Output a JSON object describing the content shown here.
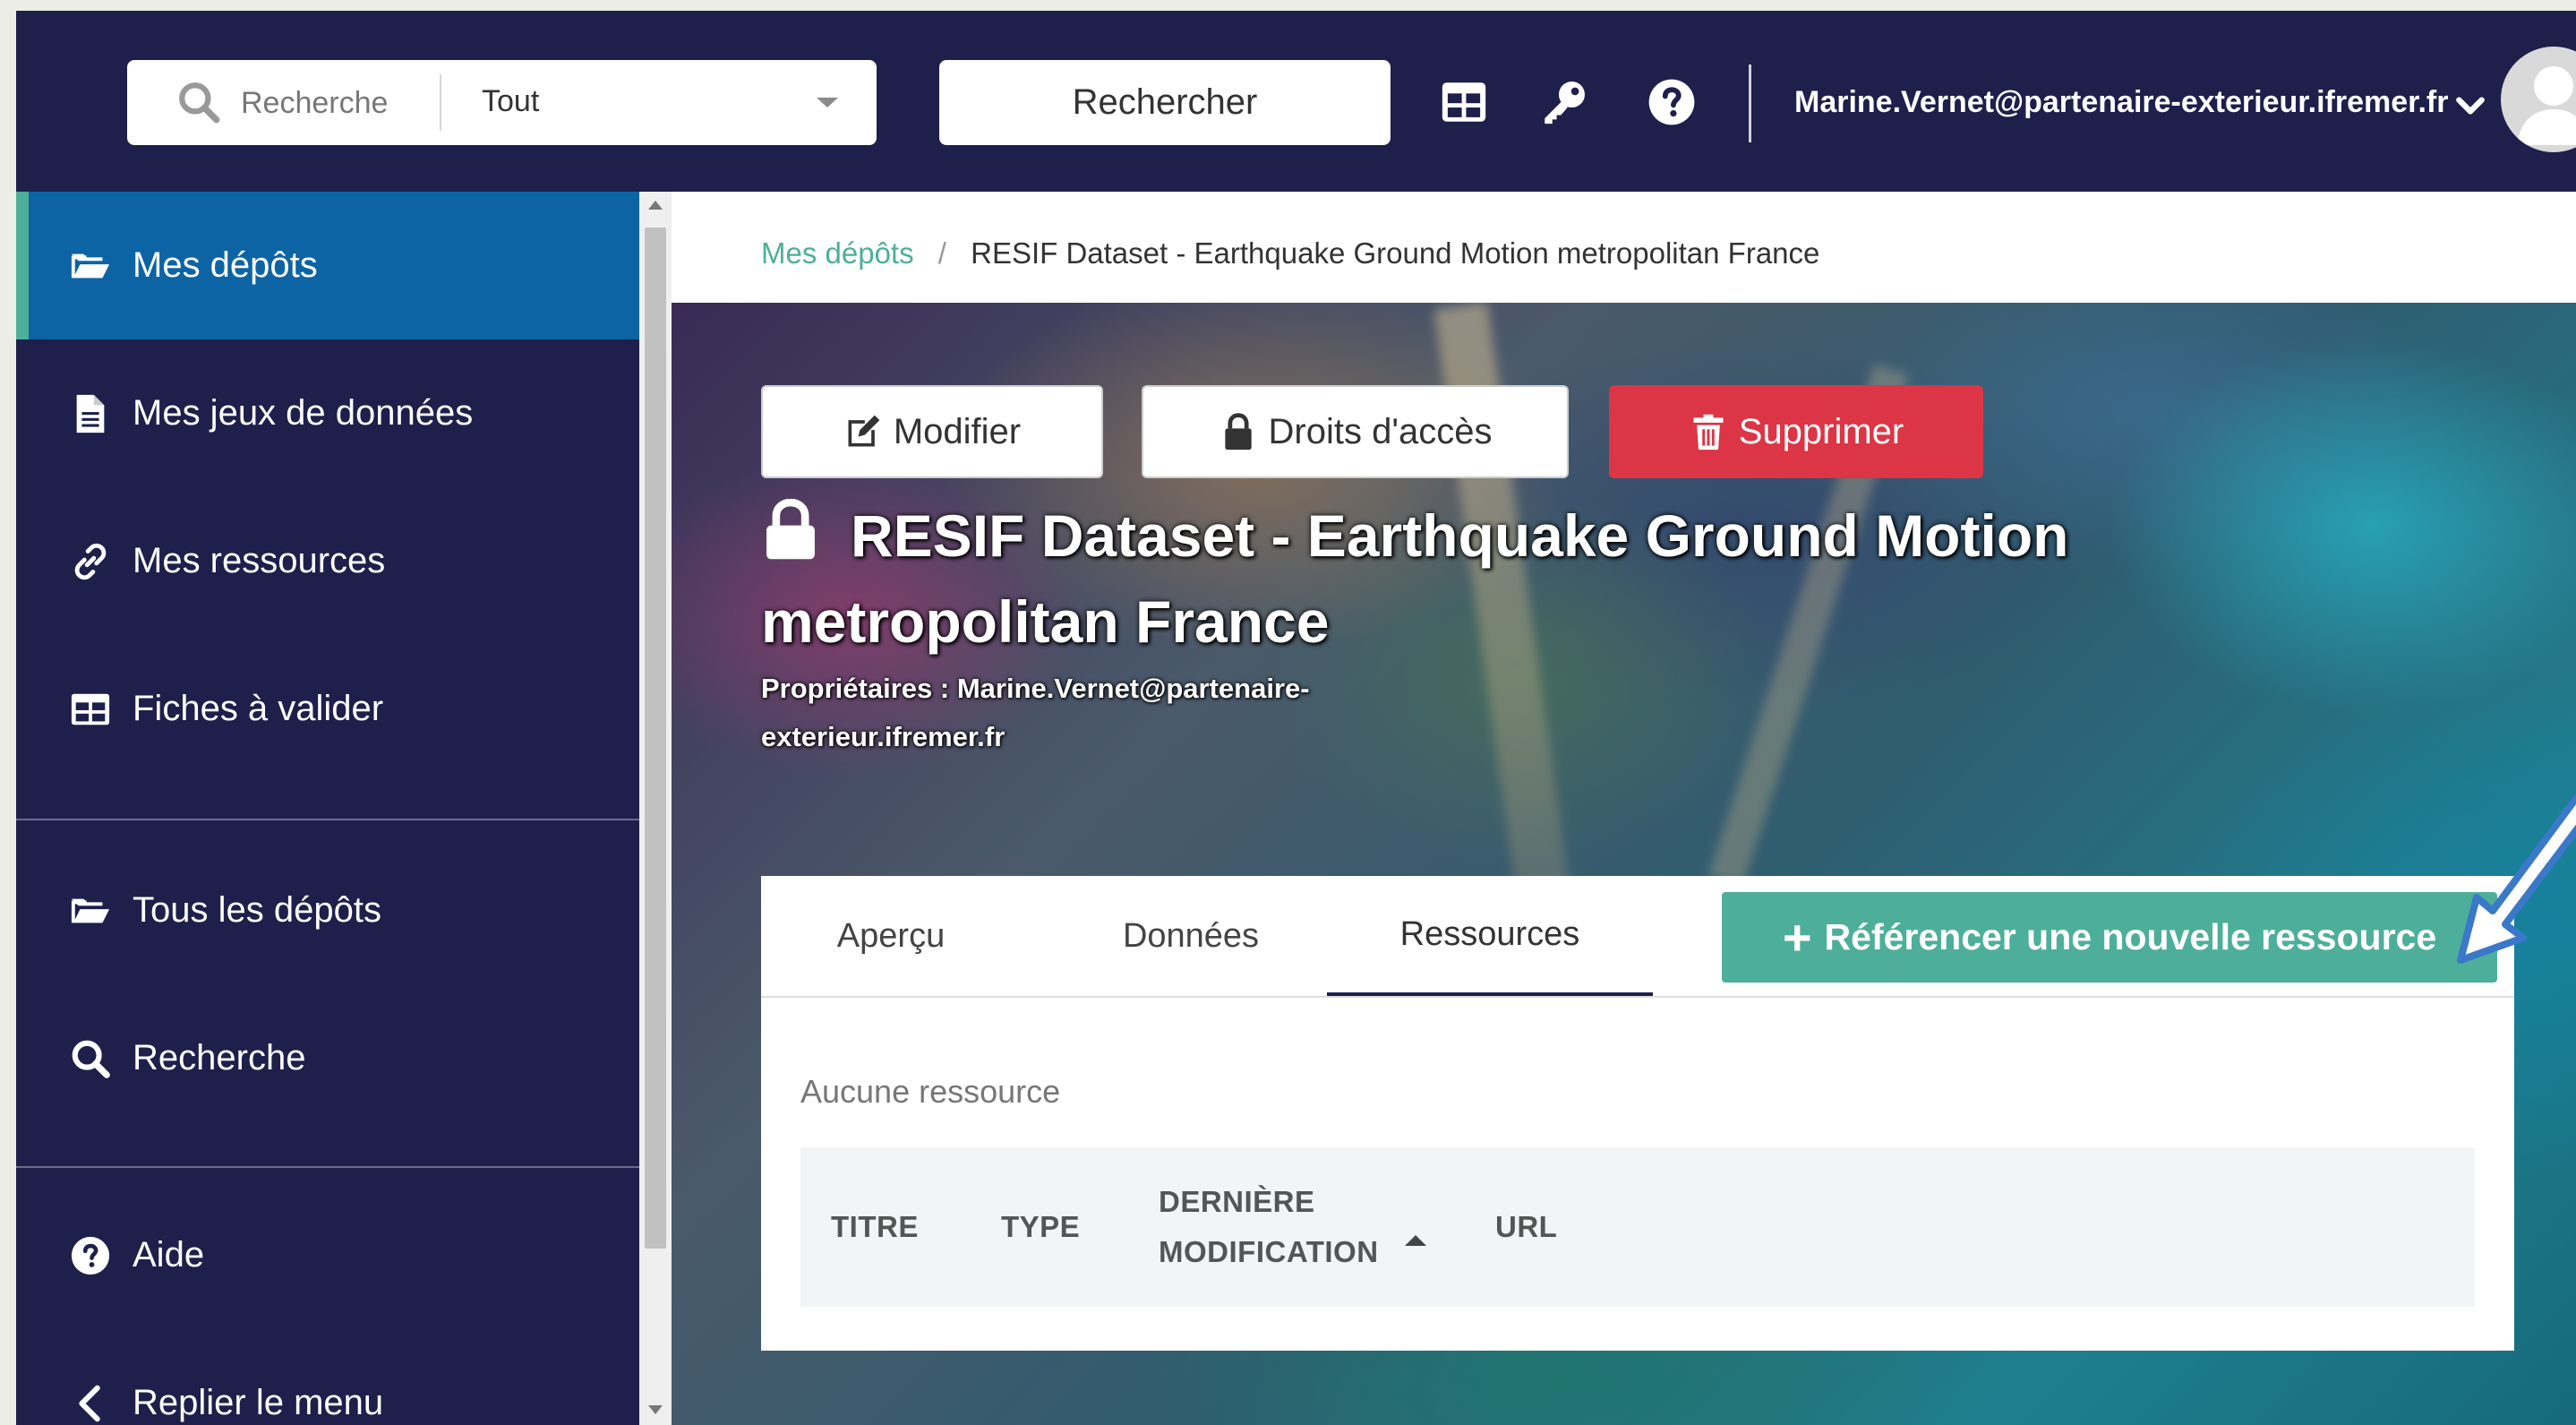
{
  "topbar": {
    "search_placeholder": "Recherche",
    "scope_value": "Tout",
    "search_button": "Rechercher",
    "icons": [
      "table-icon",
      "key-icon",
      "help-circle-icon"
    ],
    "user_email": "Marine.Vernet@partenaire-exterieur.ifremer.fr"
  },
  "sidebar": {
    "items": [
      {
        "label": "Mes dépôts",
        "icon": "folder-open-icon",
        "active": true
      },
      {
        "label": "Mes jeux de données",
        "icon": "file-text-icon"
      },
      {
        "label": "Mes ressources",
        "icon": "link-icon"
      },
      {
        "label": "Fiches à valider",
        "icon": "table-icon"
      },
      {
        "label": "Tous les dépôts",
        "icon": "folder-open-icon"
      },
      {
        "label": "Recherche",
        "icon": "search-icon"
      },
      {
        "label": "Aide",
        "icon": "help-circle-icon"
      },
      {
        "label": "Replier le menu",
        "icon": "chevron-left-icon"
      }
    ]
  },
  "breadcrumb": {
    "root": "Mes dépôts",
    "separator": "/",
    "current": "RESIF Dataset - Earthquake Ground Motion metropolitan France"
  },
  "actions": {
    "edit": "Modifier",
    "access": "Droits d'accès",
    "delete": "Supprimer"
  },
  "dataset": {
    "title": "RESIF Dataset - Earthquake Ground Motion metropolitan France",
    "owners_label": "Propriétaires :",
    "owners_value": "Marine.Vernet@partenaire-exterieur.ifremer.fr"
  },
  "tabs": [
    {
      "label": "Aperçu"
    },
    {
      "label": "Données"
    },
    {
      "label": "Ressources",
      "active": true
    }
  ],
  "ref_button": "Référencer une nouvelle ressource",
  "resources": {
    "empty_text": "Aucune ressource",
    "columns": [
      "TITRE",
      "TYPE",
      "DERNIÈRE",
      "MODIFICATION",
      "URL"
    ]
  },
  "colors": {
    "navy": "#1e1f4b",
    "active_blue": "#0c64a4",
    "accent_green": "#4daf9a",
    "danger_red": "#dc3545"
  }
}
